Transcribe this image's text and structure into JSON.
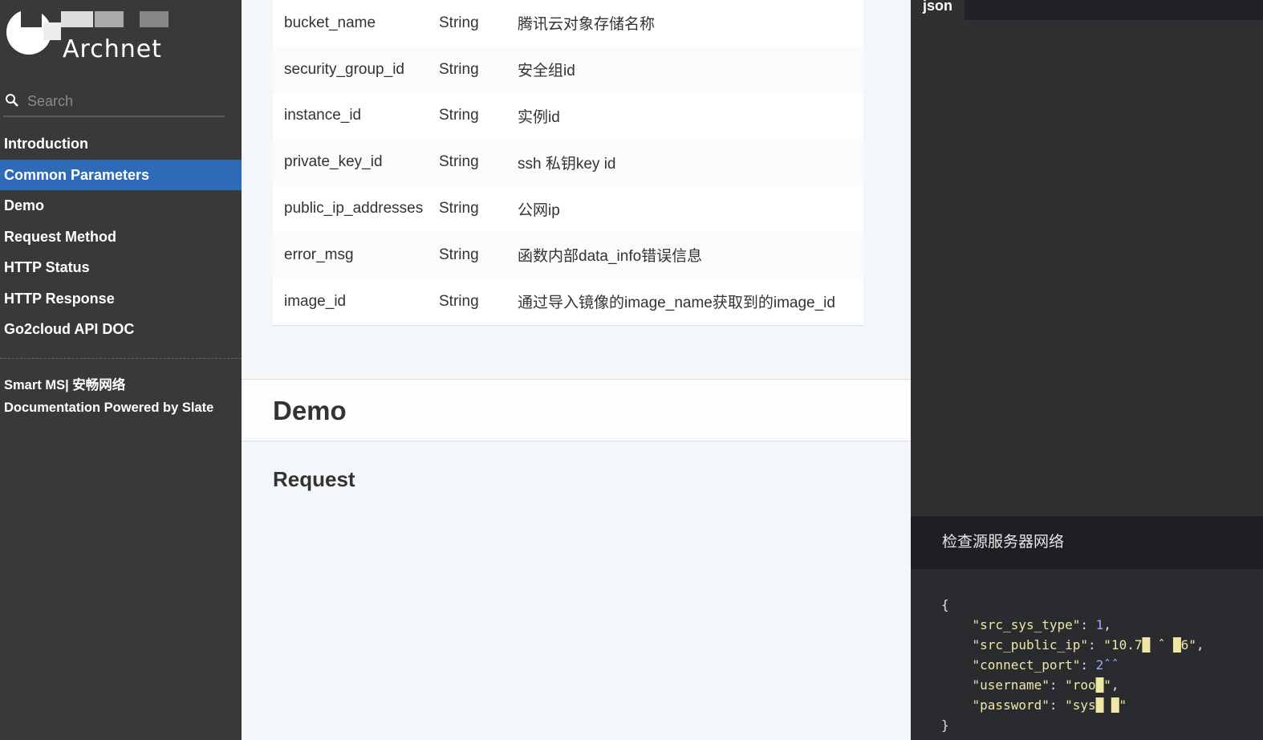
{
  "sidebar": {
    "logo_text": "Archnet",
    "search": {
      "placeholder": "Search",
      "value": ""
    },
    "nav": [
      {
        "label": "Introduction",
        "active": false
      },
      {
        "label": "Common Parameters",
        "active": true
      },
      {
        "label": "Demo",
        "active": false
      },
      {
        "label": "Request Method",
        "active": false
      },
      {
        "label": "HTTP Status",
        "active": false
      },
      {
        "label": "HTTP Response",
        "active": false
      },
      {
        "label": "Go2cloud API DOC",
        "active": false
      }
    ],
    "footer": {
      "line1": "Smart MS| 安畅网络",
      "line2": "Documentation Powered by Slate"
    }
  },
  "main": {
    "params": [
      {
        "name": "bucket_name",
        "type": "String",
        "desc": "腾讯云对象存储名称"
      },
      {
        "name": "security_group_id",
        "type": "String",
        "desc": "安全组id"
      },
      {
        "name": "instance_id",
        "type": "String",
        "desc": "实例id"
      },
      {
        "name": "private_key_id",
        "type": "String",
        "desc": "ssh 私钥key id"
      },
      {
        "name": "public_ip_addresses",
        "type": "String",
        "desc": "公网ip"
      },
      {
        "name": "error_msg",
        "type": "String",
        "desc": "函数内部data_info错误信息"
      },
      {
        "name": "image_id",
        "type": "String",
        "desc": "通过导入镜像的image_name获取到的image_id"
      }
    ],
    "demo_heading": "Demo",
    "request_heading": "Request"
  },
  "code_panel": {
    "tab_label": "json",
    "caption": "检查源服务器网络",
    "lines": {
      "open": "{",
      "l1_key": "\"src_sys_type\"",
      "l1_val": "1",
      "l2_key": "\"src_public_ip\"",
      "l2_val": "\"10.7█ ˆ █6\"",
      "l3_key": "\"connect_port\"",
      "l3_val": "2ˆˆ",
      "l4_key": "\"username\"",
      "l4_val": "\"roo█\"",
      "l5_key": "\"password\"",
      "l5_val": "\"sys█ █\"",
      "close": "}"
    }
  },
  "colors": {
    "sidebar_bg": "#393939",
    "nav_active": "#2d6bb7",
    "code_bg": "#2f3032",
    "string_color": "#f0e6a6",
    "number_color": "#a7a7f5"
  }
}
